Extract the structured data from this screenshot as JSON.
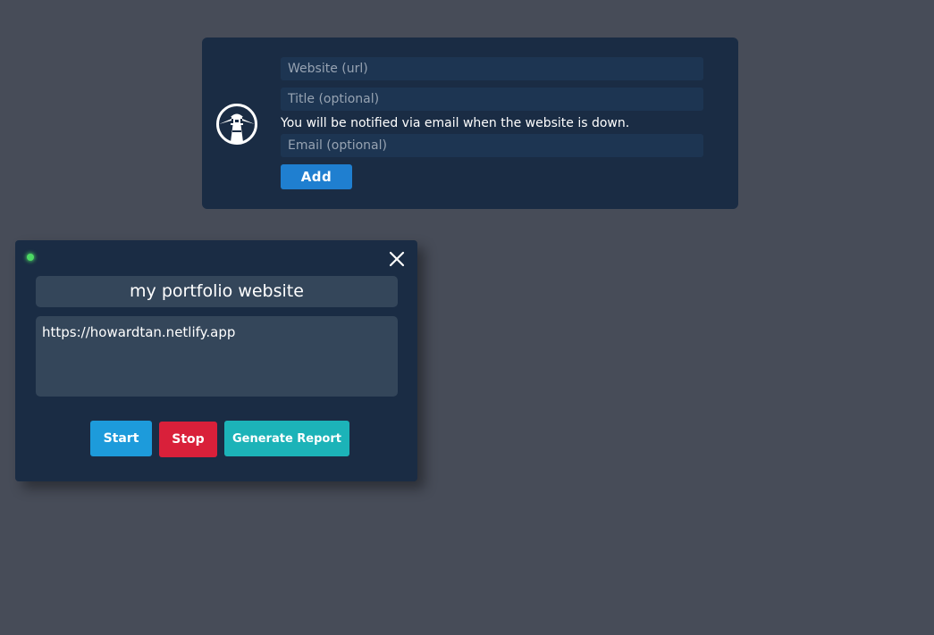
{
  "add_form": {
    "url_placeholder": "Website (url)",
    "title_placeholder": "Title (optional)",
    "notice": "You will be notified via email when the website is down.",
    "email_placeholder": "Email (optional)",
    "add_label": "Add",
    "logo_icon": "lighthouse-icon"
  },
  "monitor": {
    "status": "online",
    "status_color": "#4cd964",
    "title": "my portfolio website",
    "url": "https://howardtan.netlify.app",
    "start_label": "Start",
    "stop_label": "Stop",
    "report_label": "Generate Report",
    "close_icon": "close-icon"
  },
  "colors": {
    "background": "#474c58",
    "panel": "#1a2c44",
    "add_button": "#1f7fd0",
    "start_button": "#1d9bdb",
    "stop_button": "#d9203a",
    "report_button": "#1cb3b8"
  }
}
